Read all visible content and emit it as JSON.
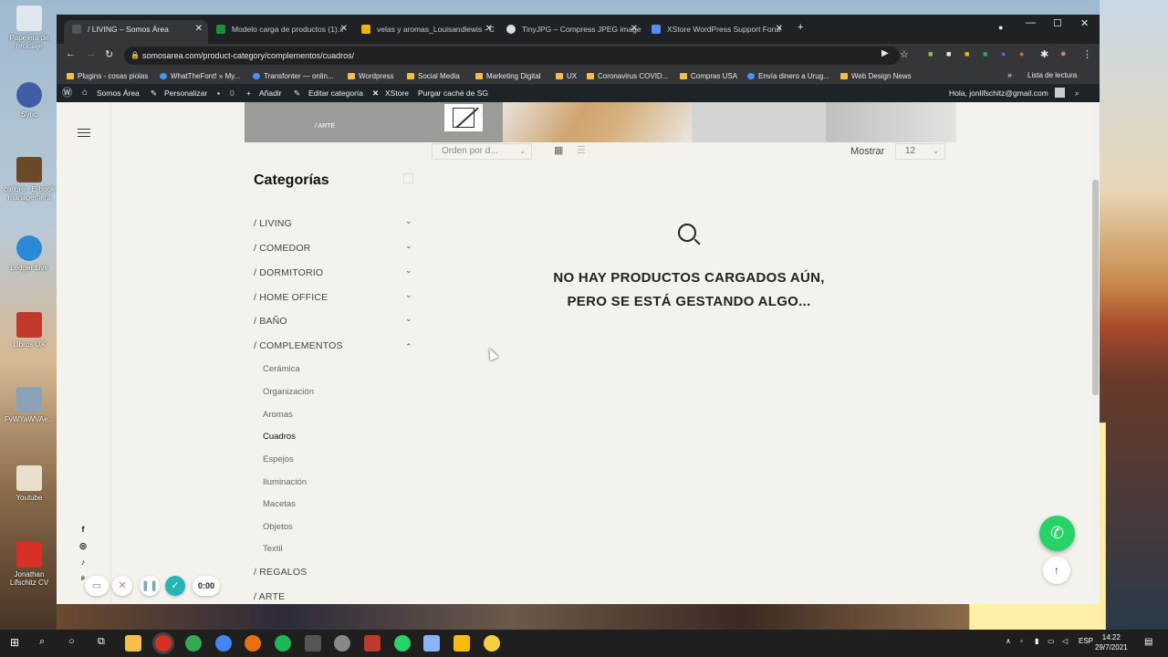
{
  "desktop": {
    "icons": [
      {
        "label": "Papelera de reciclaje"
      },
      {
        "label": "Sync"
      },
      {
        "label": "calibre - E-book management"
      },
      {
        "label": "Ledger Live"
      },
      {
        "label": "Libros UX"
      },
      {
        "label": "FvWYaWVAe..."
      },
      {
        "label": "Youtube"
      },
      {
        "label": "Jonathan Lifschitz CV"
      }
    ]
  },
  "browser": {
    "tabs": [
      {
        "label": "/ LIVING – Somos Área",
        "active": true
      },
      {
        "label": "Modelo carga de productos (1).x"
      },
      {
        "label": "velas y aromas_Louisandlewis - C"
      },
      {
        "label": "TinyJPG – Compress JPEG image"
      },
      {
        "label": "XStore WordPress Support Forur"
      }
    ],
    "url": "somosarea.com/product-category/complementos/cuadros/",
    "bookmarks": [
      "Plugins - cosas piolas",
      "WhatTheFont! » My...",
      "Transfonter — onlin...",
      "Wordpress",
      "Social Media",
      "Marketing Digital",
      "UX",
      "Coronavirus COVID...",
      "Compras USA",
      "Envía dinero a Urug...",
      "Web Design News"
    ],
    "reading_list": "Lista de lectura",
    "more": "»"
  },
  "wpbar": {
    "site": "Somos Área",
    "customize": "Personalizar",
    "comments": "0",
    "add": "Añadir",
    "edit": "Editar categoría",
    "xstore": "XStore",
    "purge": "Purgar caché de SG",
    "greeting": "Hola, jonlifschitz@gmail.com"
  },
  "page": {
    "banner_label": "/ ARTE",
    "sort_placeholder": "Orden por d...",
    "show_label": "Mostrar",
    "show_value": "12",
    "categories_title": "Categorías",
    "categories": [
      {
        "label": "/ LIVING",
        "chevron": "⌄"
      },
      {
        "label": "/ COMEDOR",
        "chevron": "⌄"
      },
      {
        "label": "/ DORMITORIO",
        "chevron": "⌄"
      },
      {
        "label": "/ HOME OFFICE",
        "chevron": "⌄"
      },
      {
        "label": "/ BAÑO",
        "chevron": "⌄"
      },
      {
        "label": "/ COMPLEMENTOS",
        "chevron": "⌃"
      }
    ],
    "subcategories": [
      "Cerámica",
      "Organización",
      "Aromas",
      "Cuadros",
      "Espejos",
      "Iluminación",
      "Macetas",
      "Objetos",
      "Textil"
    ],
    "active_subcategory": "Cuadros",
    "more_categories": [
      "/ REGALOS",
      "/ ARTE"
    ],
    "empty_line1": "NO HAY PRODUCTOS CARGADOS AÚN,",
    "empty_line2": "PERO SE ESTÁ GESTANDO ALGO...",
    "social": [
      "f",
      "◎",
      "♪",
      "ᵖ"
    ]
  },
  "recorder": {
    "time": "0:00"
  },
  "taskbar": {
    "lang": "ESP",
    "time": "14:22",
    "date": "29/7/2021"
  }
}
